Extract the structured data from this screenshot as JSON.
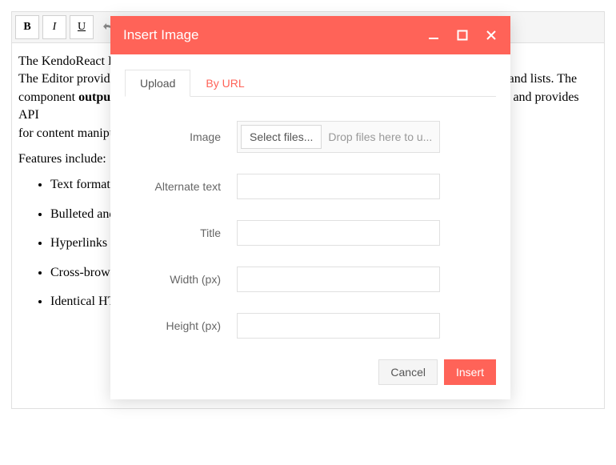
{
  "toolbar": {
    "bold": "B",
    "italic": "I",
    "underline": "U"
  },
  "editor": {
    "paragraph1_pre": "The KendoReact E",
    "paragraph1_mid": "The Editor provid",
    "paragraph1_tail1": "and lists. The",
    "paragraph2_pre": "component ",
    "paragraph2_bold": "output",
    "paragraph2_tail": "and provides API",
    "paragraph3": "for content manipu",
    "features_label": "Features include:",
    "items": [
      "Text formatt",
      "Bulleted and",
      "Hyperlinks",
      "Cross-brows",
      "Identical HT"
    ]
  },
  "dialog": {
    "title": "Insert Image",
    "tabs": {
      "upload": "Upload",
      "byurl": "By URL"
    },
    "labels": {
      "image": "Image",
      "alt": "Alternate text",
      "title": "Title",
      "width": "Width (px)",
      "height": "Height (px)"
    },
    "upload": {
      "select_btn": "Select files...",
      "drop_hint": "Drop files here to u..."
    },
    "fields": {
      "alt": "",
      "title": "",
      "width": "",
      "height": ""
    },
    "buttons": {
      "cancel": "Cancel",
      "insert": "Insert"
    }
  },
  "colors": {
    "accent": "#ff6358"
  }
}
